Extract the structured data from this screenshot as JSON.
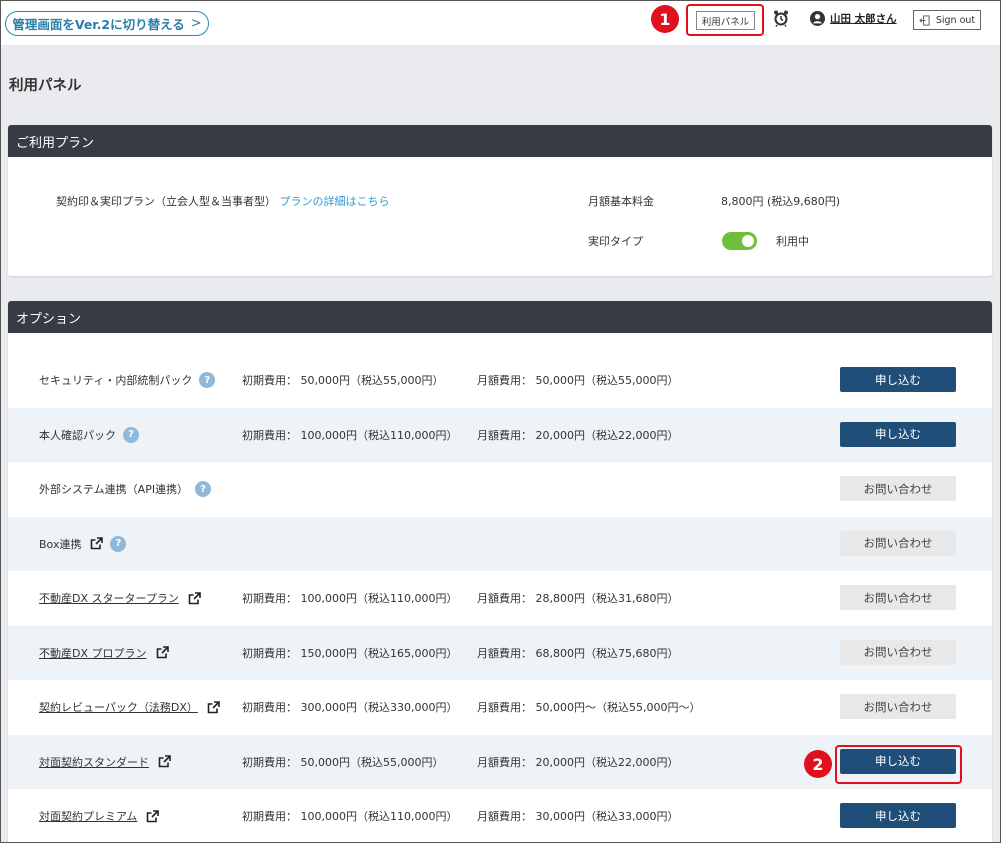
{
  "header": {
    "ver2_label": "管理画面をVer.2に切り替える",
    "ver2_chevron": ">",
    "panel_label": "利用パネル",
    "user_name": "山田 太郎さん",
    "signout_label": "Sign out"
  },
  "markers": {
    "one": "1",
    "two": "2"
  },
  "page_title": "利用パネル",
  "plan": {
    "heading": "ご利用プラン",
    "name": "契約印＆実印プラン（立会人型＆当事者型）",
    "detail_link": "プランの詳細はこちら",
    "fee_label": "月額基本料金",
    "fee_value": "8,800円 (税込9,680円)",
    "type_label": "実印タイプ",
    "type_status": "利用中",
    "type_enabled": true
  },
  "options": {
    "heading": "オプション",
    "rows": [
      {
        "name": "セキュリティ・内部統制パック",
        "initial": "初期費用： 50,000円（税込55,000円）",
        "monthly": "月額費用： 50,000円（税込55,000円）",
        "button": "申し込む"
      },
      {
        "name": "本人確認パック",
        "initial": "初期費用： 100,000円（税込110,000円）",
        "monthly": "月額費用： 20,000円（税込22,000円）",
        "button": "申し込む"
      },
      {
        "name": "外部システム連携（API連携）",
        "initial": "",
        "monthly": "",
        "button": "お問い合わせ"
      },
      {
        "name": "Box連携",
        "initial": "",
        "monthly": "",
        "button": "お問い合わせ"
      },
      {
        "name": "不動産DX スタータープラン",
        "initial": "初期費用： 100,000円（税込110,000円）",
        "monthly": "月額費用： 28,800円（税込31,680円）",
        "button": "お問い合わせ"
      },
      {
        "name": "不動産DX プロプラン",
        "initial": "初期費用： 150,000円（税込165,000円）",
        "monthly": "月額費用： 68,800円（税込75,680円）",
        "button": "お問い合わせ"
      },
      {
        "name": "契約レビューパック（法務DX）",
        "initial": "初期費用： 300,000円（税込330,000円）",
        "monthly": "月額費用： 50,000円～（税込55,000円～）",
        "button": "お問い合わせ"
      },
      {
        "name": "対面契約スタンダード",
        "initial": "初期費用： 50,000円（税込55,000円）",
        "monthly": "月額費用： 20,000円（税込22,000円）",
        "button": "申し込む"
      },
      {
        "name": "対面契約プレミアム",
        "initial": "初期費用： 100,000円（税込110,000円）",
        "monthly": "月額費用： 30,000円（税込33,000円）",
        "button": "申し込む"
      }
    ]
  },
  "colors": {
    "header_bar": "#373c44",
    "apply_button": "#1f4e79",
    "marker": "#e0101d",
    "toggle_on": "#6fbf3a",
    "link": "#2a9ad0"
  }
}
